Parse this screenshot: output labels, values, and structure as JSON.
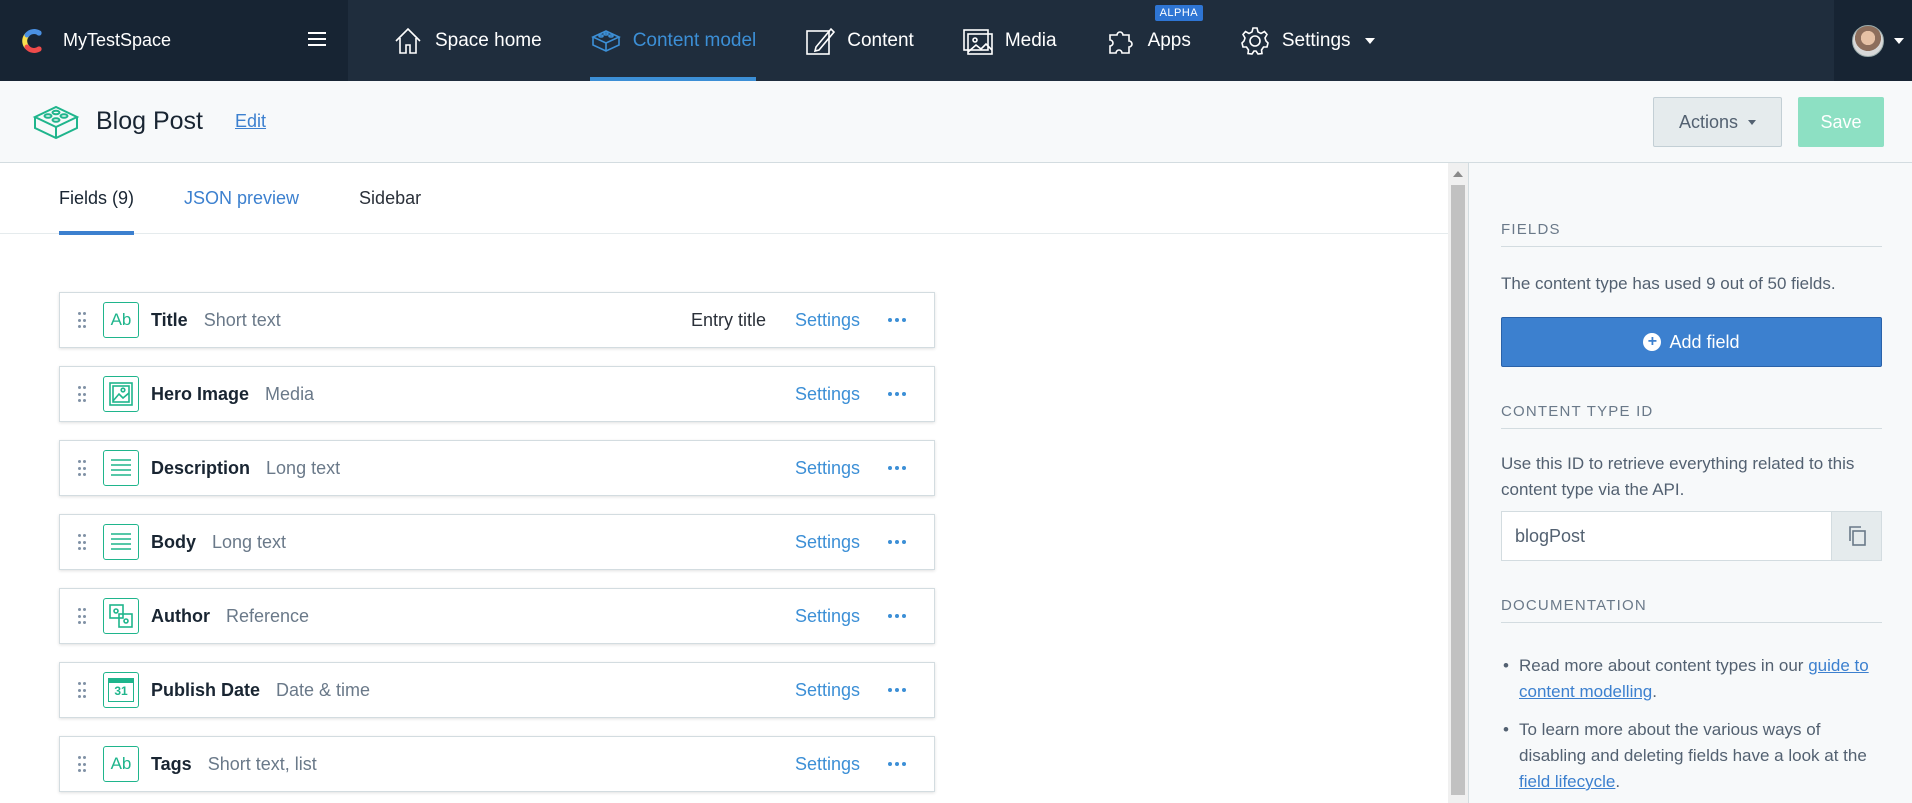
{
  "topbar": {
    "space_name": "MyTestSpace",
    "nav": [
      {
        "label": "Space home",
        "icon": "home-icon"
      },
      {
        "label": "Content model",
        "icon": "content-model-icon"
      },
      {
        "label": "Content",
        "icon": "content-pen-icon"
      },
      {
        "label": "Media",
        "icon": "media-icon"
      },
      {
        "label": "Apps",
        "icon": "puzzle-icon",
        "badge": "ALPHA"
      },
      {
        "label": "Settings",
        "icon": "gear-icon"
      }
    ],
    "active_nav": "Content model"
  },
  "header": {
    "title": "Blog Post",
    "edit_label": "Edit",
    "actions_label": "Actions",
    "save_label": "Save"
  },
  "tabs": [
    {
      "label": "Fields (9)",
      "active": true
    },
    {
      "label": "JSON preview",
      "active": false
    },
    {
      "label": "Sidebar",
      "active": false
    }
  ],
  "fields": [
    {
      "name": "Title",
      "type": "Short text",
      "icon": "text-ab-icon",
      "entry_title": "Entry title",
      "settings": "Settings"
    },
    {
      "name": "Hero Image",
      "type": "Media",
      "icon": "image-icon",
      "settings": "Settings"
    },
    {
      "name": "Description",
      "type": "Long text",
      "icon": "long-text-icon",
      "settings": "Settings"
    },
    {
      "name": "Body",
      "type": "Long text",
      "icon": "long-text-icon",
      "settings": "Settings"
    },
    {
      "name": "Author",
      "type": "Reference",
      "icon": "reference-icon",
      "settings": "Settings"
    },
    {
      "name": "Publish Date",
      "type": "Date & time",
      "icon": "calendar-icon",
      "icon_text": "31",
      "settings": "Settings"
    },
    {
      "name": "Tags",
      "type": "Short text, list",
      "icon": "text-ab-icon",
      "settings": "Settings"
    }
  ],
  "sidebar": {
    "fields_heading": "FIELDS",
    "fields_text": "The content type has used 9 out of 50 fields.",
    "add_field_label": "Add field",
    "id_heading": "CONTENT TYPE ID",
    "id_text": "Use this ID to retrieve everything related to this content type via the API.",
    "id_value": "blogPost",
    "doc_heading": "DOCUMENTATION",
    "doc_items": [
      {
        "before": "Read more about content types in our ",
        "link": "guide to content modelling",
        "after": "."
      },
      {
        "before": "To learn more about the various ways of disabling and deleting fields have a look at the ",
        "link": "field lifecycle",
        "after": "."
      }
    ]
  },
  "colors": {
    "nav_bg": "#1f2d3d",
    "accent": "#3c80cf",
    "field_icon": "#1fb58c",
    "save_disabled": "#8de0c3"
  }
}
